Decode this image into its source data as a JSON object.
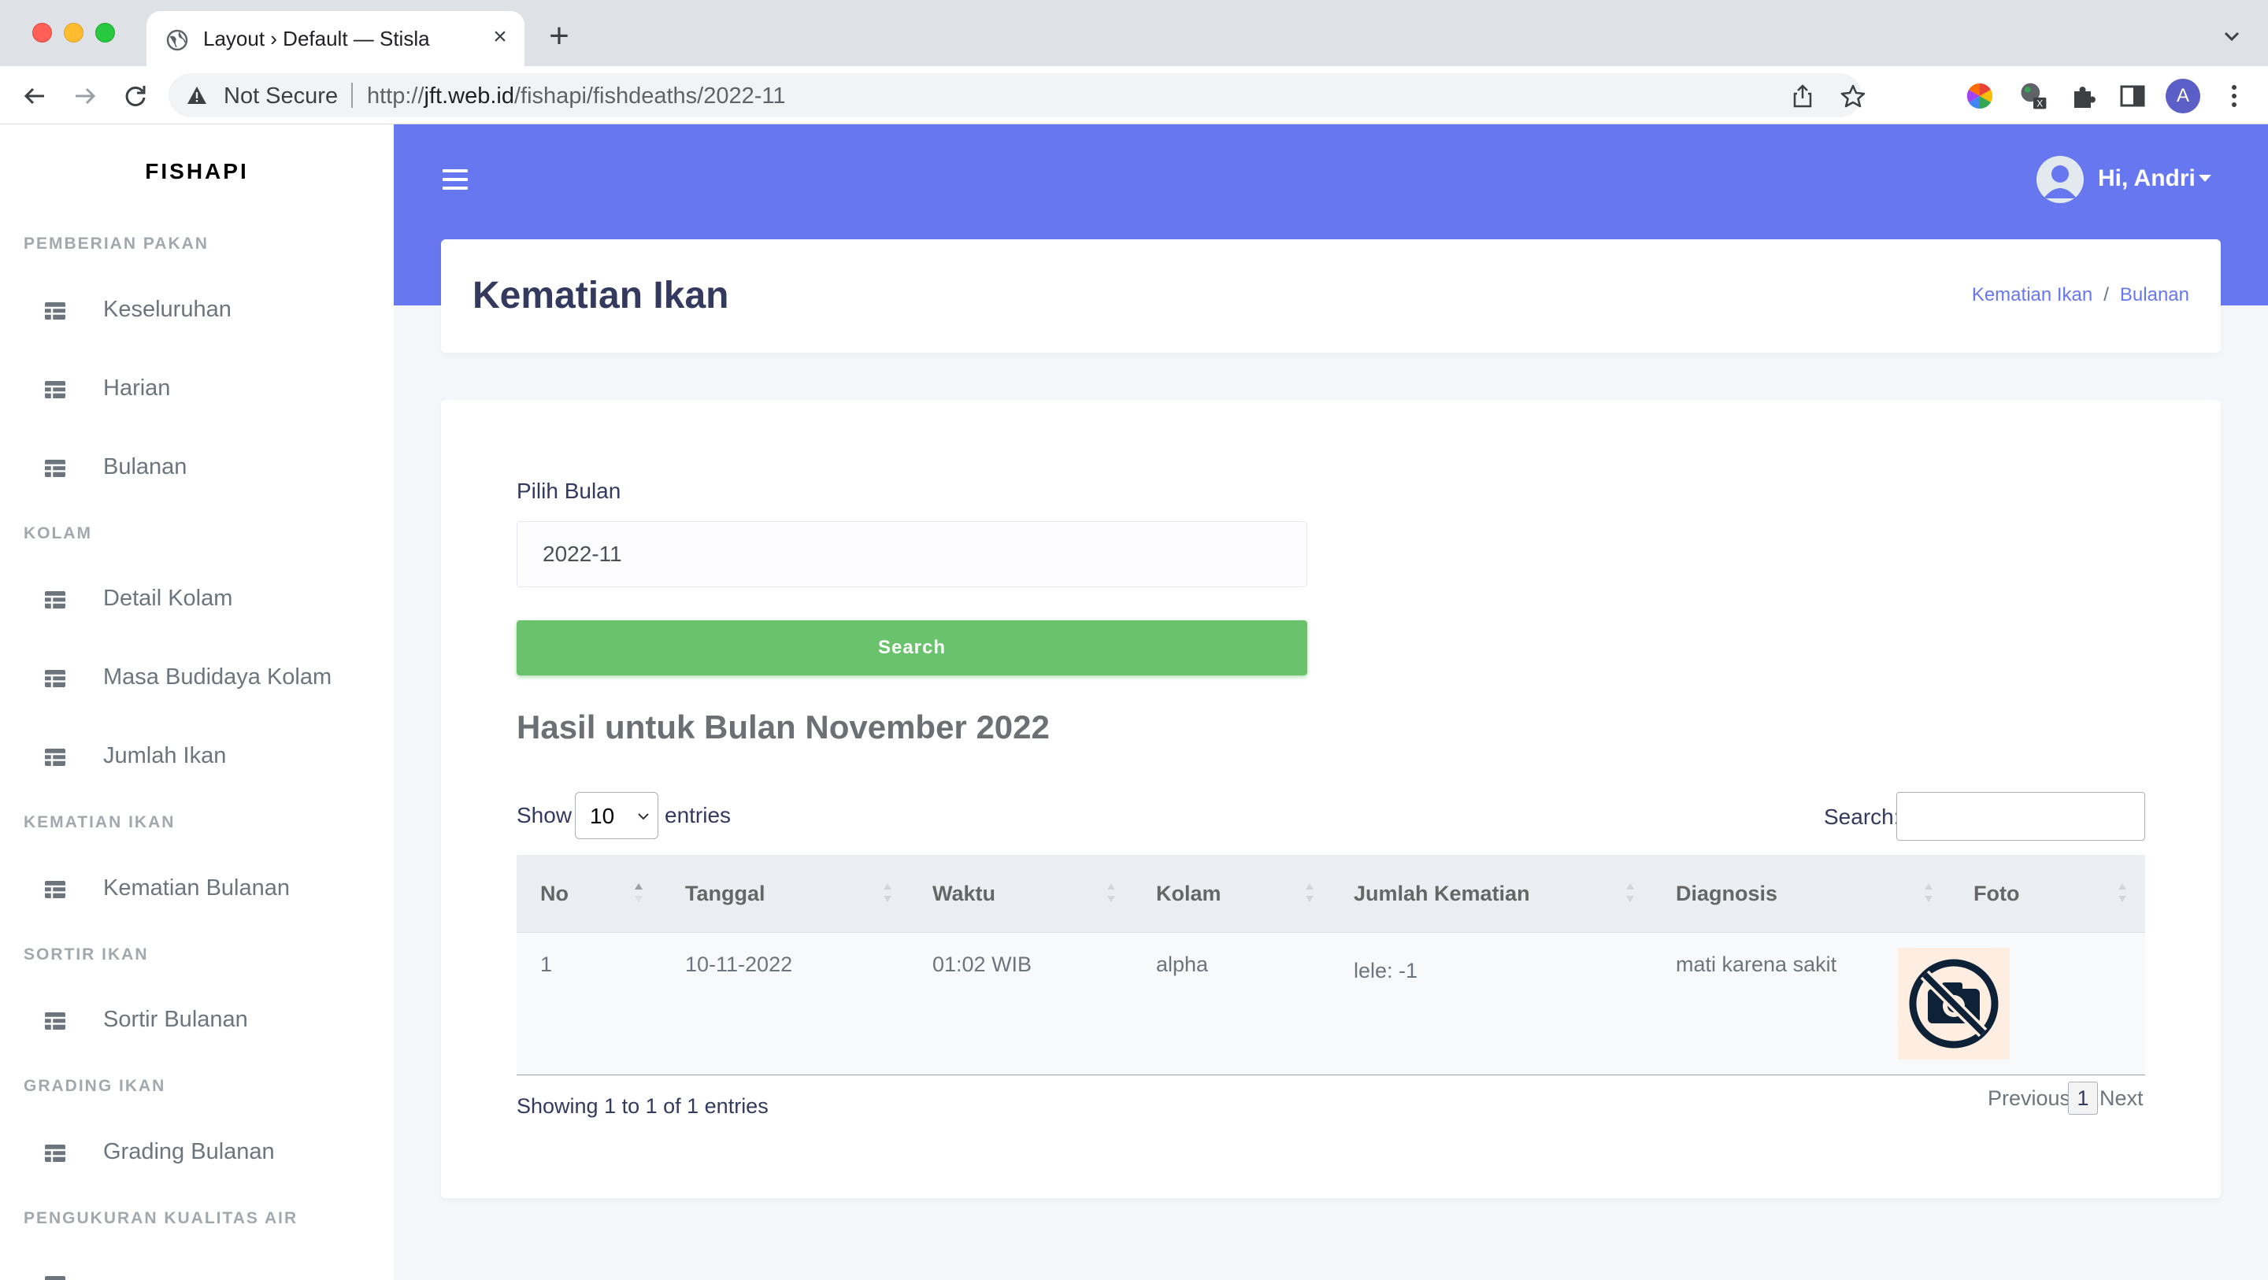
{
  "browser": {
    "tab_title": "Layout › Default — Stisla",
    "security_label": "Not Secure",
    "url_prefix": "http://",
    "url_host": "jft.web.id",
    "url_path": "/fishapi/fishdeaths/2022-11",
    "profile_initial": "A"
  },
  "sidebar": {
    "brand": "FISHAPI",
    "sections": [
      {
        "header": "PEMBERIAN PAKAN",
        "items": [
          "Keseluruhan",
          "Harian",
          "Bulanan"
        ]
      },
      {
        "header": "KOLAM",
        "items": [
          "Detail Kolam",
          "Masa Budidaya Kolam",
          "Jumlah Ikan"
        ]
      },
      {
        "header": "KEMATIAN IKAN",
        "items": [
          "Kematian Bulanan"
        ]
      },
      {
        "header": "SORTIR IKAN",
        "items": [
          "Sortir Bulanan"
        ]
      },
      {
        "header": "GRADING IKAN",
        "items": [
          "Grading Bulanan"
        ]
      },
      {
        "header": "PENGUKURAN KUALITAS AIR",
        "items": []
      }
    ]
  },
  "navbar": {
    "greeting": "Hi, Andri",
    "accent_color": "#6777ef"
  },
  "section_header": {
    "title": "Kematian Ikan",
    "breadcrumb": [
      "Kematian Ikan",
      "Bulanan"
    ]
  },
  "form": {
    "month_label": "Pilih Bulan",
    "month_value": "2022-11",
    "search_button": "Search",
    "button_color": "#6ac26d"
  },
  "results": {
    "title": "Hasil untuk Bulan November 2022",
    "show_label": "Show",
    "entries_label": "entries",
    "page_length": "10",
    "filter_label": "Search:",
    "columns": [
      "No",
      "Tanggal",
      "Waktu",
      "Kolam",
      "Jumlah Kematian",
      "Diagnosis",
      "Foto"
    ],
    "rows": [
      {
        "no": "1",
        "tanggal": "10-11-2022",
        "waktu": "01:02 WIB",
        "kolam": "alpha",
        "jumlah": "lele: -1",
        "diagnosis": "mati karena sakit",
        "foto": "no-photo-icon"
      }
    ],
    "info": "Showing 1 to 1 of 1 entries",
    "pager": {
      "previous": "Previous",
      "current": "1",
      "next": "Next"
    }
  }
}
